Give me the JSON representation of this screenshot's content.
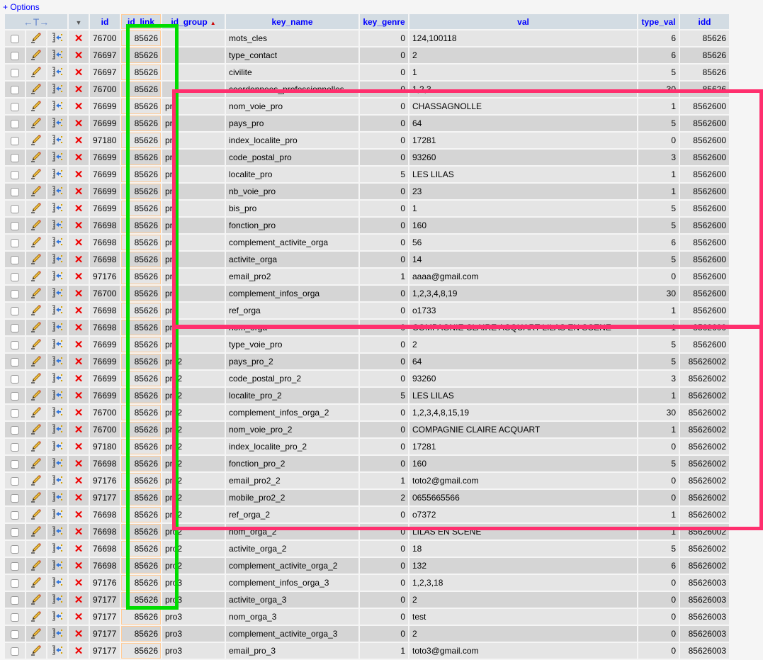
{
  "options_label": "+ Options",
  "header": {
    "move_arrows": "←T→",
    "cols": [
      "id",
      "id_link",
      "id_group",
      "key_name",
      "key_genre",
      "val",
      "type_val",
      "idd"
    ],
    "sort_indicator": "▲"
  },
  "highlight_colors": {
    "green": "#00dd00",
    "pink": "#ff2f6e",
    "link_border": "#ffcc99",
    "header_text": "#0000ff"
  },
  "rows": [
    {
      "id": "76700",
      "id_link": "85626",
      "id_group": "",
      "key_name": "mots_cles",
      "key_genre": "0",
      "val": "124,100118",
      "type_val": "6",
      "idd": "85626"
    },
    {
      "id": "76697",
      "id_link": "85626",
      "id_group": "",
      "key_name": "type_contact",
      "key_genre": "0",
      "val": "2",
      "type_val": "6",
      "idd": "85626"
    },
    {
      "id": "76697",
      "id_link": "85626",
      "id_group": "",
      "key_name": "civilite",
      "key_genre": "0",
      "val": "1",
      "type_val": "5",
      "idd": "85626"
    },
    {
      "id": "76700",
      "id_link": "85626",
      "id_group": "",
      "key_name": "coordonnees_professionnelles",
      "key_genre": "0",
      "val": "1,2,3",
      "type_val": "30",
      "idd": "85626"
    },
    {
      "id": "76699",
      "id_link": "85626",
      "id_group": "pro",
      "key_name": "nom_voie_pro",
      "key_genre": "0",
      "val": "CHASSAGNOLLE",
      "type_val": "1",
      "idd": "8562600"
    },
    {
      "id": "76699",
      "id_link": "85626",
      "id_group": "pro",
      "key_name": "pays_pro",
      "key_genre": "0",
      "val": "64",
      "type_val": "5",
      "idd": "8562600"
    },
    {
      "id": "97180",
      "id_link": "85626",
      "id_group": "pro",
      "key_name": "index_localite_pro",
      "key_genre": "0",
      "val": "17281",
      "type_val": "0",
      "idd": "8562600"
    },
    {
      "id": "76699",
      "id_link": "85626",
      "id_group": "pro",
      "key_name": "code_postal_pro",
      "key_genre": "0",
      "val": "93260",
      "type_val": "3",
      "idd": "8562600"
    },
    {
      "id": "76699",
      "id_link": "85626",
      "id_group": "pro",
      "key_name": "localite_pro",
      "key_genre": "5",
      "val": "LES LILAS",
      "type_val": "1",
      "idd": "8562600"
    },
    {
      "id": "76699",
      "id_link": "85626",
      "id_group": "pro",
      "key_name": "nb_voie_pro",
      "key_genre": "0",
      "val": "23",
      "type_val": "1",
      "idd": "8562600"
    },
    {
      "id": "76699",
      "id_link": "85626",
      "id_group": "pro",
      "key_name": "bis_pro",
      "key_genre": "0",
      "val": "1",
      "type_val": "5",
      "idd": "8562600"
    },
    {
      "id": "76698",
      "id_link": "85626",
      "id_group": "pro",
      "key_name": "fonction_pro",
      "key_genre": "0",
      "val": "160",
      "type_val": "5",
      "idd": "8562600"
    },
    {
      "id": "76698",
      "id_link": "85626",
      "id_group": "pro",
      "key_name": "complement_activite_orga",
      "key_genre": "0",
      "val": "56",
      "type_val": "6",
      "idd": "8562600"
    },
    {
      "id": "76698",
      "id_link": "85626",
      "id_group": "pro",
      "key_name": "activite_orga",
      "key_genre": "0",
      "val": "14",
      "type_val": "5",
      "idd": "8562600"
    },
    {
      "id": "97176",
      "id_link": "85626",
      "id_group": "pro",
      "key_name": "email_pro2",
      "key_genre": "1",
      "val": "aaaa@gmail.com",
      "type_val": "0",
      "idd": "8562600"
    },
    {
      "id": "76700",
      "id_link": "85626",
      "id_group": "pro",
      "key_name": "complement_infos_orga",
      "key_genre": "0",
      "val": "1,2,3,4,8,19",
      "type_val": "30",
      "idd": "8562600"
    },
    {
      "id": "76698",
      "id_link": "85626",
      "id_group": "pro",
      "key_name": "ref_orga",
      "key_genre": "0",
      "val": "o1733",
      "type_val": "1",
      "idd": "8562600"
    },
    {
      "id": "76698",
      "id_link": "85626",
      "id_group": "pro",
      "key_name": "nom_orga",
      "key_genre": "0",
      "val": "COMPAGNIE CLAIRE ACQUART LILAS EN SCENE",
      "type_val": "1",
      "idd": "8562600"
    },
    {
      "id": "76699",
      "id_link": "85626",
      "id_group": "pro",
      "key_name": "type_voie_pro",
      "key_genre": "0",
      "val": "2",
      "type_val": "5",
      "idd": "8562600"
    },
    {
      "id": "76699",
      "id_link": "85626",
      "id_group": "pro2",
      "key_name": "pays_pro_2",
      "key_genre": "0",
      "val": "64",
      "type_val": "5",
      "idd": "85626002"
    },
    {
      "id": "76699",
      "id_link": "85626",
      "id_group": "pro2",
      "key_name": "code_postal_pro_2",
      "key_genre": "0",
      "val": "93260",
      "type_val": "3",
      "idd": "85626002"
    },
    {
      "id": "76699",
      "id_link": "85626",
      "id_group": "pro2",
      "key_name": "localite_pro_2",
      "key_genre": "5",
      "val": "LES LILAS",
      "type_val": "1",
      "idd": "85626002"
    },
    {
      "id": "76700",
      "id_link": "85626",
      "id_group": "pro2",
      "key_name": "complement_infos_orga_2",
      "key_genre": "0",
      "val": "1,2,3,4,8,15,19",
      "type_val": "30",
      "idd": "85626002"
    },
    {
      "id": "76700",
      "id_link": "85626",
      "id_group": "pro2",
      "key_name": "nom_voie_pro_2",
      "key_genre": "0",
      "val": "COMPAGNIE CLAIRE ACQUART",
      "type_val": "1",
      "idd": "85626002"
    },
    {
      "id": "97180",
      "id_link": "85626",
      "id_group": "pro2",
      "key_name": "index_localite_pro_2",
      "key_genre": "0",
      "val": "17281",
      "type_val": "0",
      "idd": "85626002"
    },
    {
      "id": "76698",
      "id_link": "85626",
      "id_group": "pro2",
      "key_name": "fonction_pro_2",
      "key_genre": "0",
      "val": "160",
      "type_val": "5",
      "idd": "85626002"
    },
    {
      "id": "97176",
      "id_link": "85626",
      "id_group": "pro2",
      "key_name": "email_pro2_2",
      "key_genre": "1",
      "val": "toto2@gmail.com",
      "type_val": "0",
      "idd": "85626002"
    },
    {
      "id": "97177",
      "id_link": "85626",
      "id_group": "pro2",
      "key_name": "mobile_pro2_2",
      "key_genre": "2",
      "val": "0655665566",
      "type_val": "0",
      "idd": "85626002"
    },
    {
      "id": "76698",
      "id_link": "85626",
      "id_group": "pro2",
      "key_name": "ref_orga_2",
      "key_genre": "0",
      "val": "o7372",
      "type_val": "1",
      "idd": "85626002"
    },
    {
      "id": "76698",
      "id_link": "85626",
      "id_group": "pro2",
      "key_name": "nom_orga_2",
      "key_genre": "0",
      "val": "LILAS EN SCENE",
      "type_val": "1",
      "idd": "85626002"
    },
    {
      "id": "76698",
      "id_link": "85626",
      "id_group": "pro2",
      "key_name": "activite_orga_2",
      "key_genre": "0",
      "val": "18",
      "type_val": "5",
      "idd": "85626002"
    },
    {
      "id": "76698",
      "id_link": "85626",
      "id_group": "pro2",
      "key_name": "complement_activite_orga_2",
      "key_genre": "0",
      "val": "132",
      "type_val": "6",
      "idd": "85626002"
    },
    {
      "id": "97176",
      "id_link": "85626",
      "id_group": "pro3",
      "key_name": "complement_infos_orga_3",
      "key_genre": "0",
      "val": "1,2,3,18",
      "type_val": "0",
      "idd": "85626003"
    },
    {
      "id": "97177",
      "id_link": "85626",
      "id_group": "pro3",
      "key_name": "activite_orga_3",
      "key_genre": "0",
      "val": "2",
      "type_val": "0",
      "idd": "85626003"
    },
    {
      "id": "97177",
      "id_link": "85626",
      "id_group": "pro3",
      "key_name": "nom_orga_3",
      "key_genre": "0",
      "val": "test",
      "type_val": "0",
      "idd": "85626003"
    },
    {
      "id": "97177",
      "id_link": "85626",
      "id_group": "pro3",
      "key_name": "complement_activite_orga_3",
      "key_genre": "0",
      "val": "2",
      "type_val": "0",
      "idd": "85626003"
    },
    {
      "id": "97177",
      "id_link": "85626",
      "id_group": "pro3",
      "key_name": "email_pro_3",
      "key_genre": "1",
      "val": "toto3@gmail.com",
      "type_val": "0",
      "idd": "85626003"
    }
  ]
}
